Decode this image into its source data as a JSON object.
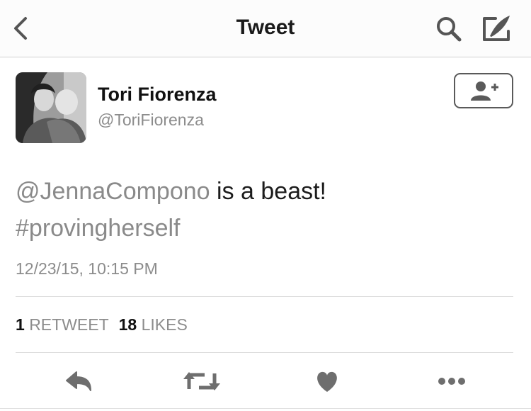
{
  "navbar": {
    "title": "Tweet",
    "back_icon": "chevron-left-icon",
    "search_icon": "search-icon",
    "compose_icon": "compose-icon"
  },
  "tweet": {
    "author": {
      "name": "Tori Fiorenza",
      "handle": "@ToriFiorenza"
    },
    "text": {
      "mention": "@JennaCompono",
      "body": " is a beast!",
      "hashtag": "#provingherself"
    },
    "timestamp": "12/23/15, 10:15 PM",
    "stats": {
      "retweets_count": "1",
      "retweets_label": "RETWEET",
      "likes_count": "18",
      "likes_label": "LIKES"
    }
  },
  "actions": {
    "reply_icon": "reply-icon",
    "retweet_icon": "retweet-icon",
    "like_icon": "heart-icon",
    "more_icon": "more-icon"
  },
  "colors": {
    "text": "#1c1c1c",
    "muted": "#8c8c8c",
    "icon": "#6e6e6e"
  }
}
